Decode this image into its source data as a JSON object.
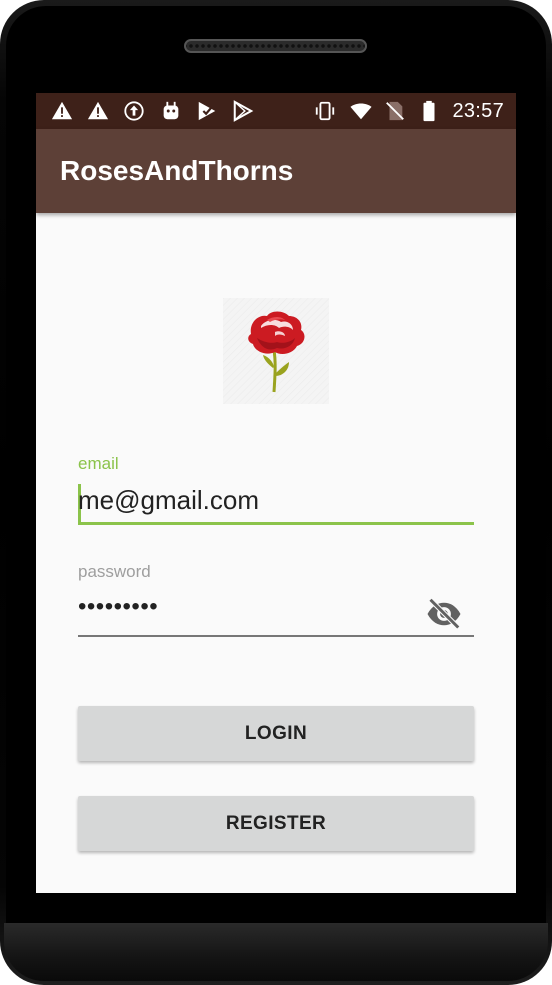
{
  "status_bar": {
    "time": "23:57",
    "left_icons": [
      "warning-icon",
      "warning-icon",
      "sync-up-icon",
      "android-debug-icon",
      "play-store-check-icon",
      "play-store-icon"
    ],
    "right_icons": [
      "vibrate-icon",
      "wifi-icon",
      "no-sim-icon",
      "battery-icon"
    ],
    "background": "#3e2119"
  },
  "app_bar": {
    "title": "RosesAndThorns",
    "background": "#5d4037"
  },
  "logo": {
    "icon": "rose-icon"
  },
  "form": {
    "email_label": "email",
    "email_value": "me@gmail.com",
    "password_label": "password",
    "password_value": "•••••••••",
    "toggle_icon": "eye-off-icon",
    "accent_color": "#8bc34a"
  },
  "buttons": {
    "login": "LOGIN",
    "register": "REGISTER"
  }
}
